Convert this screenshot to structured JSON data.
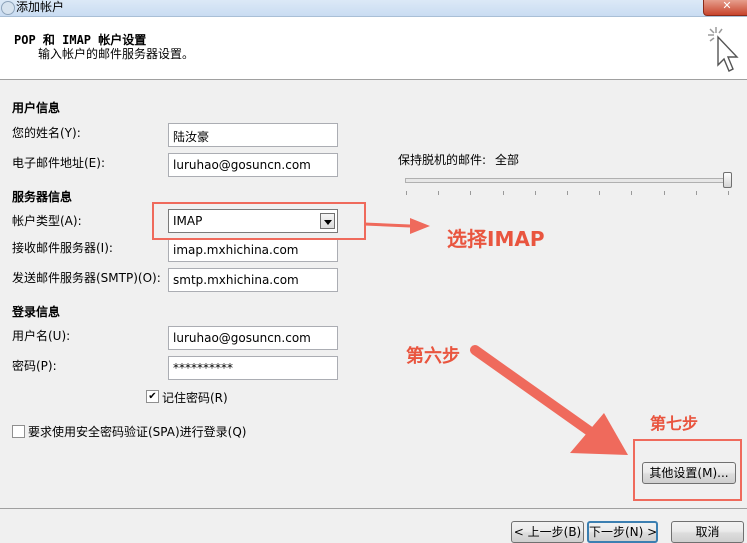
{
  "window": {
    "title": "添加帐户"
  },
  "header": {
    "title": "POP 和 IMAP 帐户设置",
    "subtitle": "输入帐户的邮件服务器设置。"
  },
  "user_info": {
    "section_label": "用户信息",
    "name_label": "您的姓名(Y):",
    "name_value": "陆汝豪",
    "email_label": "电子邮件地址(E):",
    "email_value": "luruhao@gosuncn.com"
  },
  "server_info": {
    "section_label": "服务器信息",
    "account_type_label": "帐户类型(A):",
    "account_type_value": "IMAP",
    "incoming_label": "接收邮件服务器(I):",
    "incoming_value": "imap.mxhichina.com",
    "outgoing_label": "发送邮件服务器(SMTP)(O):",
    "outgoing_value": "smtp.mxhichina.com"
  },
  "login_info": {
    "section_label": "登录信息",
    "username_label": "用户名(U):",
    "username_value": "luruhao@gosuncn.com",
    "password_label": "密码(P):",
    "password_value": "**********",
    "remember_label": "记住密码(R)",
    "remember_checked": true
  },
  "spa": {
    "label": "要求使用安全密码验证(SPA)进行登录(Q)",
    "checked": false
  },
  "offline": {
    "label": "保持脱机的邮件:",
    "value": "全部",
    "slider_level": 1.0
  },
  "buttons": {
    "more_settings": "其他设置(M)...",
    "back": "< 上一步(B)",
    "next": "下一步(N) >",
    "cancel": "取消"
  },
  "annotations": {
    "select_imap": "选择IMAP",
    "step6": "第六步",
    "step7": "第七步",
    "color": "#ef6a5c"
  }
}
